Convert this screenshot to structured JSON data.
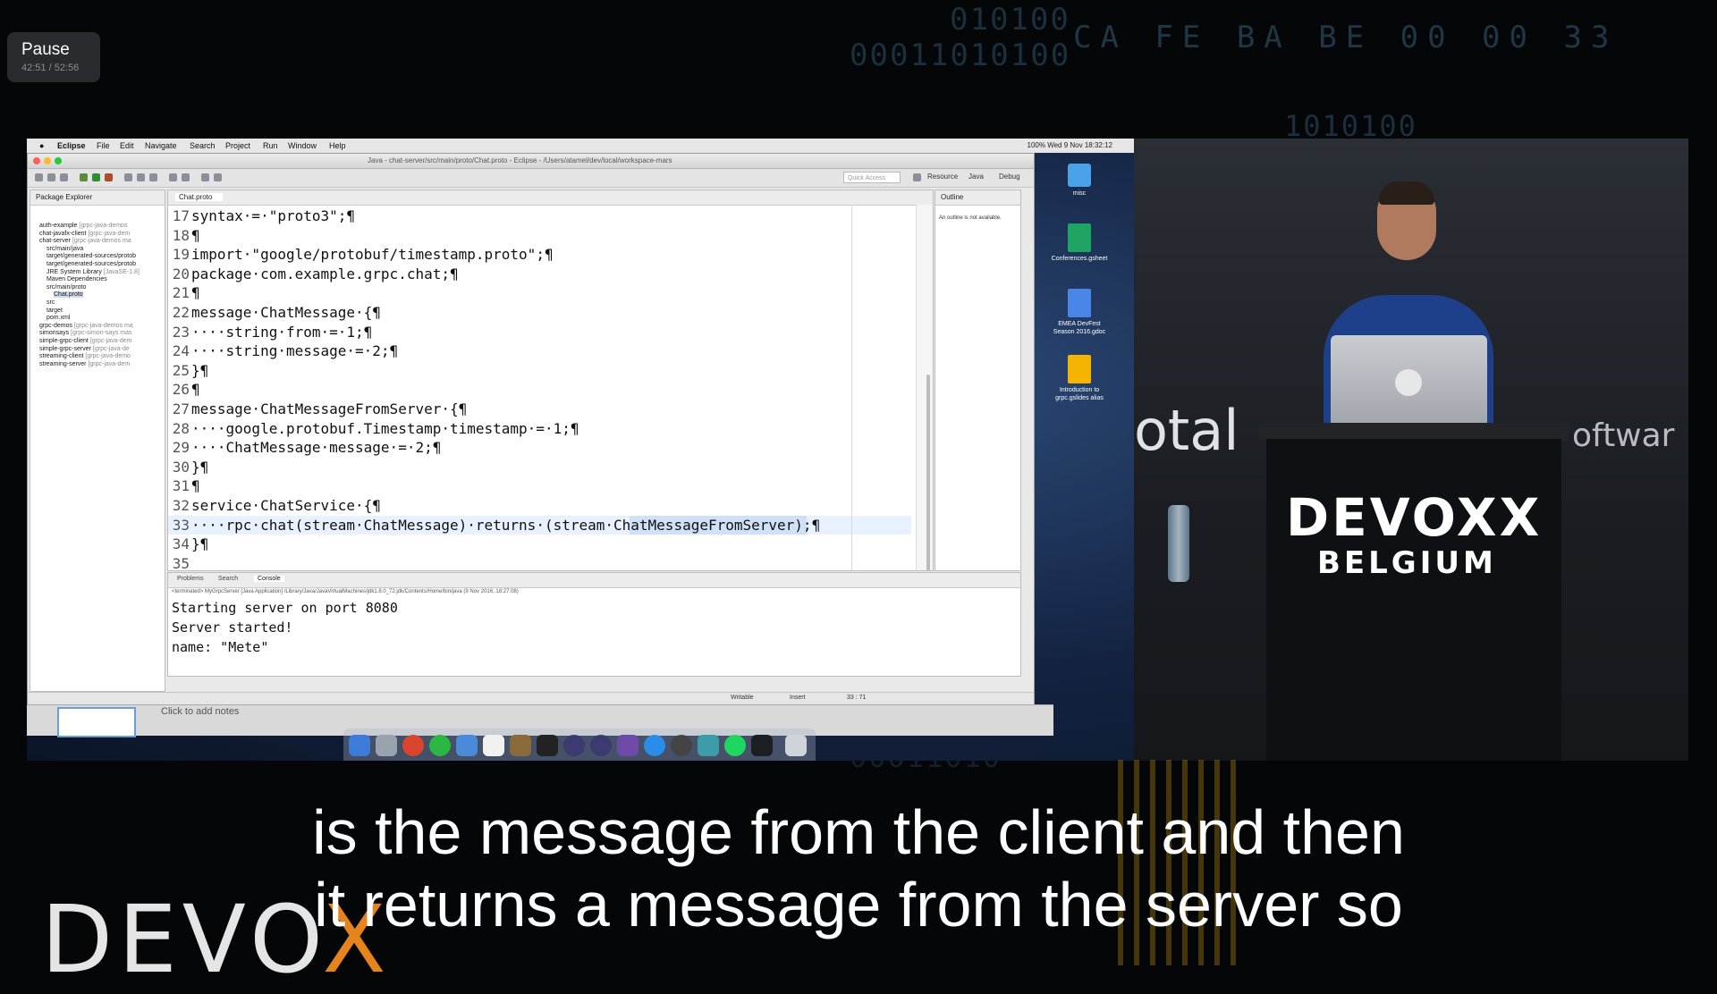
{
  "player": {
    "pause_label": "Pause",
    "time": "42:51 / 52:56"
  },
  "background": {
    "binary_1": "010100",
    "binary_2": "00011010100",
    "hex": "CA FE BA BE 00 00 33",
    "binary_3": "1010100",
    "binary_4": "00011010"
  },
  "menubar": {
    "apple": "",
    "app": "Eclipse",
    "items": [
      "File",
      "Edit",
      "Navigate",
      "Search",
      "Project",
      "Run",
      "Window",
      "Help"
    ],
    "status": "100% Wed 9 Nov 18:32:12"
  },
  "window": {
    "title": "Java - chat-server/src/main/proto/Chat.proto - Eclipse - /Users/atamel/dev/local/workspace-mars",
    "quick_access": "Quick Access",
    "perspectives": [
      "Resource",
      "Java",
      "Debug"
    ]
  },
  "package_explorer": {
    "tab": "Package Explorer",
    "items": [
      {
        "label": "auth-example",
        "dim": "[grpc-java-demos"
      },
      {
        "label": "chat-javafx-client",
        "dim": "[grpc-java-dem"
      },
      {
        "label": "chat-server",
        "dim": "[grpc-java-demos ma"
      },
      {
        "label": "src/main/java",
        "dim": ""
      },
      {
        "label": "target/generated-sources/protob",
        "dim": ""
      },
      {
        "label": "target/generated-sources/protob",
        "dim": ""
      },
      {
        "label": "JRE System Library",
        "dim": "[JavaSE-1.8]"
      },
      {
        "label": "Maven Dependencies",
        "dim": ""
      },
      {
        "label": "src/main/proto",
        "dim": ""
      },
      {
        "label": "Chat.proto",
        "dim": ""
      },
      {
        "label": "src",
        "dim": ""
      },
      {
        "label": "target",
        "dim": ""
      },
      {
        "label": "pom.xml",
        "dim": ""
      },
      {
        "label": "grpc-demos",
        "dim": "[grpc-java-demos ma"
      },
      {
        "label": "simonsays",
        "dim": "[grpc-simon-says mas"
      },
      {
        "label": "simple-grpc-client",
        "dim": "[grpc-java-dem"
      },
      {
        "label": "simple-grpc-server",
        "dim": "[grpc-java-de"
      },
      {
        "label": "streaming-client",
        "dim": "[grpc-java-demo"
      },
      {
        "label": "streaming-server",
        "dim": "[grpc-java-dem"
      }
    ]
  },
  "editor": {
    "tab": "Chat.proto",
    "lines": [
      {
        "n": "17",
        "code": "syntax·=·\"proto3\";¶"
      },
      {
        "n": "18",
        "code": "¶"
      },
      {
        "n": "19",
        "code": "import·\"google/protobuf/timestamp.proto\";¶"
      },
      {
        "n": "20",
        "code": "package·com.example.grpc.chat;¶"
      },
      {
        "n": "21",
        "code": "¶"
      },
      {
        "n": "22",
        "code": "message·ChatMessage·{¶"
      },
      {
        "n": "23",
        "code": "····string·from·=·1;¶"
      },
      {
        "n": "24",
        "code": "····string·message·=·2;¶"
      },
      {
        "n": "25",
        "code": "}¶"
      },
      {
        "n": "26",
        "code": "¶"
      },
      {
        "n": "27",
        "code": "message·ChatMessageFromServer·{¶"
      },
      {
        "n": "28",
        "code": "····google.protobuf.Timestamp·timestamp·=·1;¶"
      },
      {
        "n": "29",
        "code": "····ChatMessage·message·=·2;¶"
      },
      {
        "n": "30",
        "code": "}¶"
      },
      {
        "n": "31",
        "code": "¶"
      },
      {
        "n": "32",
        "code": "service·ChatService·{¶"
      },
      {
        "n": "33",
        "code": "····rpc·chat(stream·ChatMessage)·returns·(stream·ChatMessageFromServer);¶"
      },
      {
        "n": "34",
        "code": "}¶"
      },
      {
        "n": "35",
        "code": ""
      }
    ]
  },
  "outline": {
    "tab": "Outline",
    "message": "An outline is not available."
  },
  "console": {
    "tabs": [
      "Problems",
      "Search",
      "Console"
    ],
    "terminated": "<terminated> MyGrpcServer [Java Application] /Library/Java/JavaVirtualMachines/jdk1.8.0_72.jdk/Contents/Home/bin/java (9 Nov 2016, 18:27:08)",
    "lines": [
      "Starting server on port 8080",
      "Server started!",
      "name: \"Mete\""
    ]
  },
  "statusbar": {
    "writable": "Writable",
    "insert": "Insert",
    "position": "33 : 71"
  },
  "presentation": {
    "notes": "Click to add notes"
  },
  "desktop_icons": [
    {
      "label": "misc",
      "color": "#4aa3e8"
    },
    {
      "label": "Conferences.gsheet",
      "color": "#1fa463"
    },
    {
      "label": "EMEA DevFest Season 2016.gdoc",
      "color": "#4a86e8"
    },
    {
      "label": "Introduction to grpc.gslides alias",
      "color": "#f4b400"
    }
  ],
  "stage": {
    "banner_left": "otal",
    "banner_right": "oftwar",
    "podium_logo": "DEVOXX",
    "podium_sub": "BELGIUM"
  },
  "subtitles": {
    "line1": "is the message from the client and then",
    "line2": "it returns a message from the server so"
  },
  "watermark": {
    "text": "DEVO",
    "x": "X"
  }
}
